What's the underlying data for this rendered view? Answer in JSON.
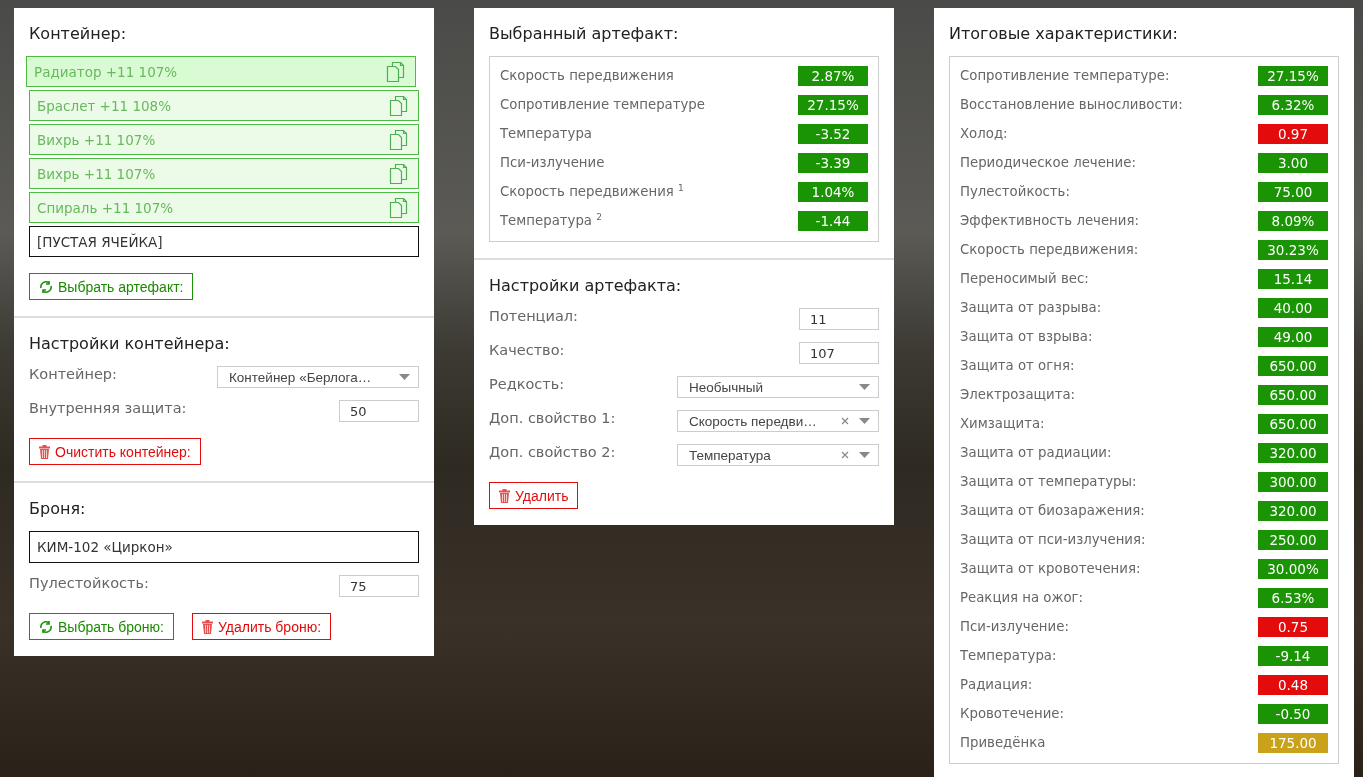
{
  "container": {
    "title": "Контейнер:",
    "slots": [
      {
        "text": "Радиатор +11 107%",
        "kind": "artifact",
        "selected": true
      },
      {
        "text": "Браслет +11 108%",
        "kind": "artifact",
        "selected": false
      },
      {
        "text": "Вихрь +11 107%",
        "kind": "artifact",
        "selected": false
      },
      {
        "text": "Вихрь +11 107%",
        "kind": "artifact",
        "selected": false
      },
      {
        "text": "Спираль +11 107%",
        "kind": "artifact",
        "selected": false
      },
      {
        "text": "[ПУСТАЯ ЯЧЕЙКА]",
        "kind": "empty",
        "selected": false
      }
    ],
    "buttons": [
      {
        "kind": "select",
        "label": "Выбрать артефакт:"
      }
    ]
  },
  "container_settings": {
    "title": "Настройки контейнера:",
    "fields": [
      {
        "label": "Контейнер:",
        "kind": "select",
        "value": "Контейнер «Берлога…",
        "clearable": false
      },
      {
        "label": "Внутренняя защита:",
        "kind": "input",
        "value": "50"
      }
    ],
    "buttons": [
      {
        "kind": "delete",
        "label": "Очистить контейнер:"
      }
    ]
  },
  "armor": {
    "title": "Броня:",
    "name": "КИМ-102 «Циркон»",
    "fields": [
      {
        "label": "Пулестойкость:",
        "kind": "input",
        "value": "75"
      }
    ],
    "buttons": [
      {
        "kind": "select",
        "label": "Выбрать броню:"
      },
      {
        "kind": "delete",
        "label": "Удалить броню:"
      }
    ]
  },
  "selected_artifact": {
    "title": "Выбранный артефакт:",
    "stats": [
      {
        "label": "Скорость передвижения",
        "value": "2.87%",
        "color": "#1a9405"
      },
      {
        "label": "Сопротивление температуре",
        "value": "27.15%",
        "color": "#1a9405"
      },
      {
        "label": "Температура",
        "value": "-3.52",
        "color": "#1a9405"
      },
      {
        "label": "Пси-излучение",
        "value": "-3.39",
        "color": "#1a9405"
      },
      {
        "label": "Скорость передвижения $^{1}$",
        "value": "1.04%",
        "color": "#1a9405"
      },
      {
        "label": "Температура $^{2}$",
        "value": "-1.44",
        "color": "#1a9405"
      }
    ]
  },
  "artifact_settings": {
    "title": "Настройки артефакта:",
    "fields": [
      {
        "label": "Потенциал:",
        "kind": "input",
        "value": "11"
      },
      {
        "label": "Качество:",
        "kind": "input",
        "value": "107"
      },
      {
        "label": "Редкость:",
        "kind": "select",
        "value": "Необычный",
        "clearable": false
      },
      {
        "label": "Доп. свойство 1:",
        "kind": "select",
        "value": "Скорость передви…",
        "clearable": true
      },
      {
        "label": "Доп. свойство 2:",
        "kind": "select",
        "value": "Температура",
        "clearable": true
      }
    ],
    "buttons": [
      {
        "kind": "delete",
        "label": "Удалить"
      }
    ]
  },
  "totals": {
    "title": "Итоговые характеристики:",
    "stats": [
      {
        "label": "Сопротивление температуре:",
        "value": "27.15%",
        "color": "#1a9405"
      },
      {
        "label": "Восстановление выносливости:",
        "value": "6.32%",
        "color": "#1a9405"
      },
      {
        "label": "Холод:",
        "value": "0.97",
        "color": "#e30b0b"
      },
      {
        "label": "Периодическое лечение:",
        "value": "3.00",
        "color": "#1a9405"
      },
      {
        "label": "Пулестойкость:",
        "value": "75.00",
        "color": "#1a9405"
      },
      {
        "label": "Эффективность лечения:",
        "value": "8.09%",
        "color": "#1a9405"
      },
      {
        "label": "Скорость передвижения:",
        "value": "30.23%",
        "color": "#1a9405"
      },
      {
        "label": "Переносимый вес:",
        "value": "15.14",
        "color": "#1a9405"
      },
      {
        "label": "Защита от разрыва:",
        "value": "40.00",
        "color": "#1a9405"
      },
      {
        "label": "Защита от взрыва:",
        "value": "49.00",
        "color": "#1a9405"
      },
      {
        "label": "Защита от огня:",
        "value": "650.00",
        "color": "#1a9405"
      },
      {
        "label": "Электрозащита:",
        "value": "650.00",
        "color": "#1a9405"
      },
      {
        "label": "Химзащита:",
        "value": "650.00",
        "color": "#1a9405"
      },
      {
        "label": "Защита от радиации:",
        "value": "320.00",
        "color": "#1a9405"
      },
      {
        "label": "Защита от температуры:",
        "value": "300.00",
        "color": "#1a9405"
      },
      {
        "label": "Защита от биозаражения:",
        "value": "320.00",
        "color": "#1a9405"
      },
      {
        "label": "Защита от пси-излучения:",
        "value": "250.00",
        "color": "#1a9405"
      },
      {
        "label": "Защита от кровотечения:",
        "value": "30.00%",
        "color": "#1a9405"
      },
      {
        "label": "Реакция на ожог:",
        "value": "6.53%",
        "color": "#1a9405"
      },
      {
        "label": "Пси-излучение:",
        "value": "0.75",
        "color": "#e30b0b"
      },
      {
        "label": "Температура:",
        "value": "-9.14",
        "color": "#1a9405"
      },
      {
        "label": "Радиация:",
        "value": "0.48",
        "color": "#e30b0b"
      },
      {
        "label": "Кровотечение:",
        "value": "-0.50",
        "color": "#1a9405"
      },
      {
        "label": "Приведёнка",
        "value": "175.00",
        "color": "#c9a21a"
      }
    ]
  }
}
